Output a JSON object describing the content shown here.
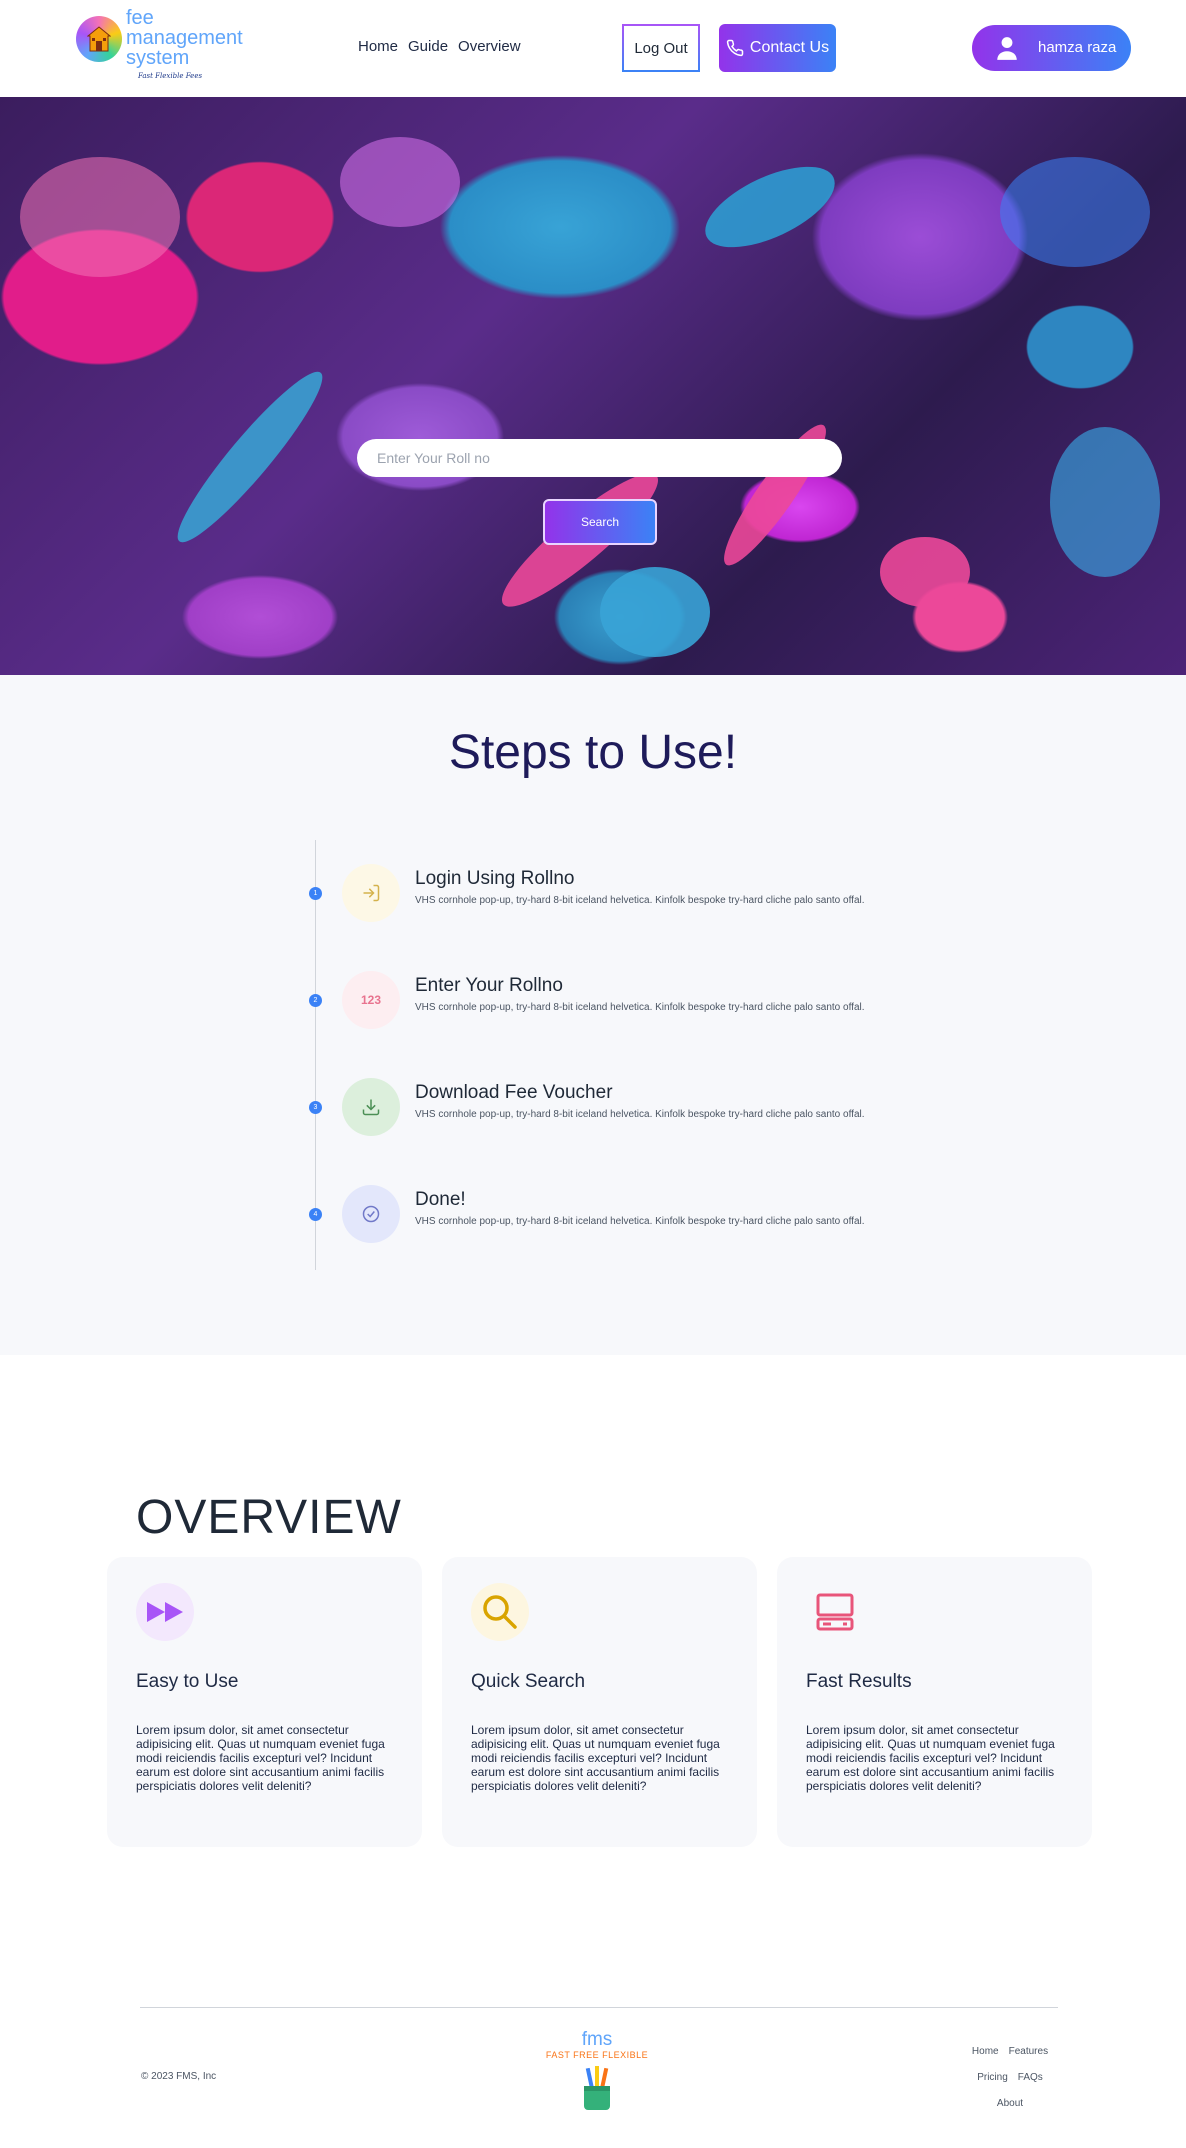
{
  "header": {
    "logo_text": "fee\nmanagement\nsystem",
    "logo_tagline": "Fast Flexible Fees",
    "nav": [
      "Home",
      "Guide",
      "Overview"
    ],
    "logout_label": "Log Out",
    "contact_label": "Contact Us",
    "user_name": "hamza raza"
  },
  "hero": {
    "search_placeholder": "Enter Your Roll no",
    "search_button": "Search"
  },
  "steps": {
    "title": "Steps to Use!",
    "items": [
      {
        "number": "1",
        "title": "Login Using Rollno",
        "desc": "VHS cornhole pop-up, try-hard 8-bit iceland helvetica. Kinfolk bespoke try-hard cliche palo santo offal.",
        "icon": "login-icon",
        "bg": "#fdf8e6",
        "color": "#d4b24c"
      },
      {
        "number": "2",
        "title": "Enter Your Rollno",
        "desc": "VHS cornhole pop-up, try-hard 8-bit iceland helvetica. Kinfolk bespoke try-hard cliche palo santo offal.",
        "icon": "numbers-icon",
        "icon_text": "123",
        "bg": "#fdeef1",
        "color": "#e8738f"
      },
      {
        "number": "3",
        "title": "Download Fee Voucher",
        "desc": "VHS cornhole pop-up, try-hard 8-bit iceland helvetica. Kinfolk bespoke try-hard cliche palo santo offal.",
        "icon": "download-icon",
        "bg": "#dcefdc",
        "color": "#4b8f55"
      },
      {
        "number": "4",
        "title": "Done!",
        "desc": "VHS cornhole pop-up, try-hard 8-bit iceland helvetica. Kinfolk bespoke try-hard cliche palo santo offal.",
        "icon": "check-circle-icon",
        "bg": "#e3e7fb",
        "color": "#7179c8"
      }
    ]
  },
  "overview": {
    "title": "OVERVIEW",
    "cards": [
      {
        "title": "Easy to Use",
        "body": "Lorem ipsum dolor, sit amet consectetur adipisicing elit. Quas ut numquam eveniet fuga modi reiciendis facilis excepturi vel? Incidunt earum est dolore sint accusantium animi facilis perspiciatis dolores velit deleniti?",
        "icon": "fast-forward-icon",
        "bg": "#f3e8fd",
        "color": "#a855f7"
      },
      {
        "title": "Quick Search",
        "body": "Lorem ipsum dolor, sit amet consectetur adipisicing elit. Quas ut numquam eveniet fuga modi reiciendis facilis excepturi vel? Incidunt earum est dolore sint accusantium animi facilis perspiciatis dolores velit deleniti?",
        "icon": "magnifier-icon",
        "bg": "#fdf6e0",
        "color": "#d9a400"
      },
      {
        "title": "Fast Results",
        "body": "Lorem ipsum dolor, sit amet consectetur adipisicing elit. Quas ut numquam eveniet fuga modi reiciendis facilis excepturi vel? Incidunt earum est dolore sint accusantium animi facilis perspiciatis dolores velit deleniti?",
        "icon": "computer-icon",
        "bg": "#f7f8fb",
        "color": "#e8557a"
      }
    ]
  },
  "footer": {
    "copyright": "© 2023 FMS, Inc",
    "brand_name": "fms",
    "brand_tagline": "FAST FREE FLEXIBLE",
    "links": [
      "Home",
      "Features",
      "Pricing",
      "FAQs",
      "About"
    ]
  }
}
